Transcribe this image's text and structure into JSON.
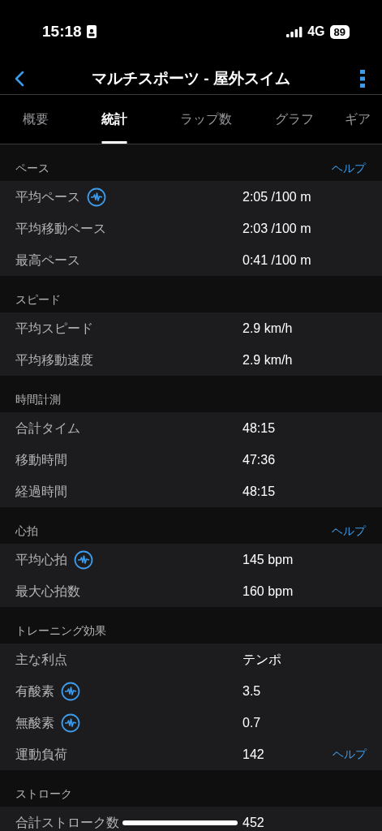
{
  "status_bar": {
    "time": "15:18",
    "network": "4G",
    "battery": "89"
  },
  "nav": {
    "title": "マルチスポーツ - 屋外スイム"
  },
  "tabs": [
    {
      "label": "概要",
      "selected": false
    },
    {
      "label": "統計",
      "selected": true
    },
    {
      "label": "ラップ数",
      "selected": false
    },
    {
      "label": "グラフ",
      "selected": false
    },
    {
      "label": "ギア",
      "selected": false
    }
  ],
  "sections": [
    {
      "title": "ペース",
      "help": "ヘルプ",
      "rows": [
        {
          "label": "平均ペース",
          "value": "2:05 /100 m",
          "info": true
        },
        {
          "label": "平均移動ペース",
          "value": "2:03 /100 m",
          "info": false
        },
        {
          "label": "最高ペース",
          "value": "0:41 /100 m",
          "info": false
        }
      ]
    },
    {
      "title": "スピード",
      "rows": [
        {
          "label": "平均スピード",
          "value": "2.9 km/h",
          "info": false
        },
        {
          "label": "平均移動速度",
          "value": "2.9 km/h",
          "info": false
        }
      ]
    },
    {
      "title": "時間計測",
      "rows": [
        {
          "label": "合計タイム",
          "value": "48:15",
          "info": false
        },
        {
          "label": "移動時間",
          "value": "47:36",
          "info": false
        },
        {
          "label": "経過時間",
          "value": "48:15",
          "info": false
        }
      ]
    },
    {
      "title": "心拍",
      "help": "ヘルプ",
      "rows": [
        {
          "label": "平均心拍",
          "value": "145 bpm",
          "info": true
        },
        {
          "label": "最大心拍数",
          "value": "160 bpm",
          "info": false
        }
      ]
    },
    {
      "title": "トレーニング効果",
      "rows": [
        {
          "label": "主な利点",
          "value": "テンポ",
          "info": false
        },
        {
          "label": "有酸素",
          "value": "3.5",
          "info": true
        },
        {
          "label": "無酸素",
          "value": "0.7",
          "info": true
        },
        {
          "label": "運動負荷",
          "value": "142",
          "info": false,
          "help": "ヘルプ"
        }
      ]
    },
    {
      "title": "ストローク",
      "rows": [
        {
          "label": "合計ストローク数",
          "value": "452",
          "info": false
        }
      ]
    }
  ]
}
